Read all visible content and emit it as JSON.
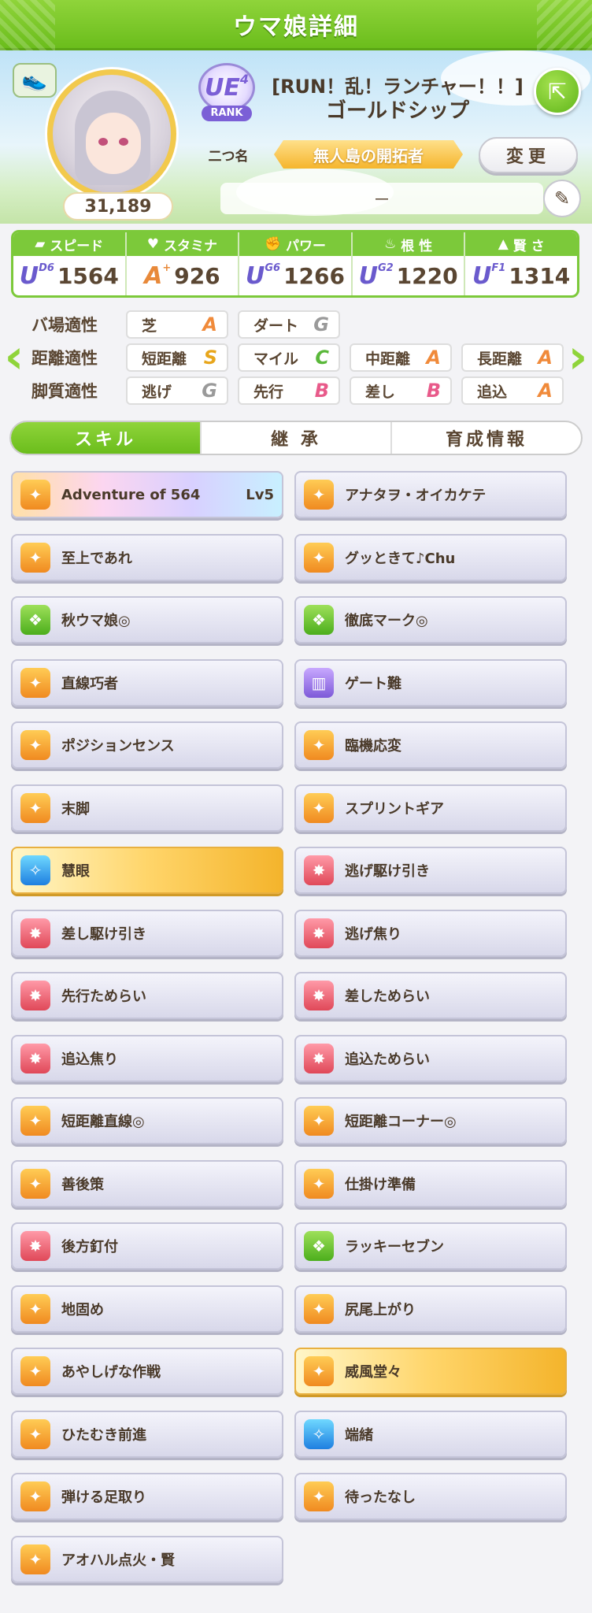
{
  "header": {
    "title": "ウマ娘詳細"
  },
  "profile": {
    "score": "31,189",
    "rank_grade": "UE",
    "rank_sub": "4",
    "rank_label": "RANK",
    "nickname": "二つ名",
    "epithet": "[RUN！乱！ランチャー！！]",
    "name": "ゴールドシップ",
    "title": "無人島の開拓者",
    "change_label": "変更",
    "memo": "－"
  },
  "stats": [
    {
      "label": "スピード",
      "icon": "shoe-icon",
      "grade": "U",
      "sub": "D6",
      "value": "1564",
      "color": "#6a5acd"
    },
    {
      "label": "スタミナ",
      "icon": "heart-icon",
      "grade": "A",
      "sub": "+",
      "value": "926",
      "color": "#e8893a"
    },
    {
      "label": "パワー",
      "icon": "muscle-icon",
      "grade": "U",
      "sub": "G6",
      "value": "1266",
      "color": "#6a5acd"
    },
    {
      "label": "根 性",
      "icon": "flame-icon",
      "grade": "U",
      "sub": "G2",
      "value": "1220",
      "color": "#6a5acd"
    },
    {
      "label": "賢 さ",
      "icon": "cap-icon",
      "grade": "U",
      "sub": "F1",
      "value": "1314",
      "color": "#6a5acd"
    }
  ],
  "aptitude": {
    "track": {
      "label": "バ場適性",
      "items": [
        {
          "name": "芝",
          "grade": "A"
        },
        {
          "name": "ダート",
          "grade": "G"
        }
      ]
    },
    "distance": {
      "label": "距離適性",
      "items": [
        {
          "name": "短距離",
          "grade": "S"
        },
        {
          "name": "マイル",
          "grade": "C"
        },
        {
          "name": "中距離",
          "grade": "A"
        },
        {
          "name": "長距離",
          "grade": "A"
        }
      ]
    },
    "style": {
      "label": "脚質適性",
      "items": [
        {
          "name": "逃げ",
          "grade": "G"
        },
        {
          "name": "先行",
          "grade": "B"
        },
        {
          "name": "差し",
          "grade": "B"
        },
        {
          "name": "追込",
          "grade": "A"
        }
      ]
    }
  },
  "grade_colors": {
    "S": "#e8a61c",
    "A": "#f08a3a",
    "B": "#e85a8a",
    "C": "#5ab83a",
    "G": "#9a9a9a"
  },
  "tabs": [
    "スキル",
    "継 承",
    "育成情報"
  ],
  "skills": [
    {
      "name": "Adventure of 564",
      "level": "Lv5",
      "icon": "orange",
      "style": "rainbow"
    },
    {
      "name": "アナタヲ・オイカケテ",
      "icon": "orange"
    },
    {
      "name": "至上であれ",
      "icon": "orange"
    },
    {
      "name": "グッときて♪Chu",
      "icon": "orange"
    },
    {
      "name": "秋ウマ娘◎",
      "icon": "green"
    },
    {
      "name": "徹底マーク◎",
      "icon": "green"
    },
    {
      "name": "直線巧者",
      "icon": "orange"
    },
    {
      "name": "ゲート難",
      "icon": "purple"
    },
    {
      "name": "ポジションセンス",
      "icon": "orange"
    },
    {
      "name": "臨機応変",
      "icon": "orange"
    },
    {
      "name": "末脚",
      "icon": "orange"
    },
    {
      "name": "スプリントギア",
      "icon": "orange"
    },
    {
      "name": "慧眼",
      "icon": "blue",
      "style": "gold"
    },
    {
      "name": "逃げ駆け引き",
      "icon": "red"
    },
    {
      "name": "差し駆け引き",
      "icon": "red"
    },
    {
      "name": "逃げ焦り",
      "icon": "red"
    },
    {
      "name": "先行ためらい",
      "icon": "red"
    },
    {
      "name": "差しためらい",
      "icon": "red"
    },
    {
      "name": "追込焦り",
      "icon": "red"
    },
    {
      "name": "追込ためらい",
      "icon": "red"
    },
    {
      "name": "短距離直線◎",
      "icon": "orange"
    },
    {
      "name": "短距離コーナー◎",
      "icon": "orange"
    },
    {
      "name": "善後策",
      "icon": "orange"
    },
    {
      "name": "仕掛け準備",
      "icon": "orange"
    },
    {
      "name": "後方釘付",
      "icon": "red"
    },
    {
      "name": "ラッキーセブン",
      "icon": "green"
    },
    {
      "name": "地固め",
      "icon": "orange"
    },
    {
      "name": "尻尾上がり",
      "icon": "orange"
    },
    {
      "name": "あやしげな作戦",
      "icon": "orange"
    },
    {
      "name": "威風堂々",
      "icon": "orange",
      "style": "gold"
    },
    {
      "name": "ひたむき前進",
      "icon": "orange"
    },
    {
      "name": "端緒",
      "icon": "blue"
    },
    {
      "name": "弾ける足取り",
      "icon": "orange"
    },
    {
      "name": "待ったなし",
      "icon": "orange"
    },
    {
      "name": "アオハル点火・賢",
      "icon": "orange"
    }
  ]
}
